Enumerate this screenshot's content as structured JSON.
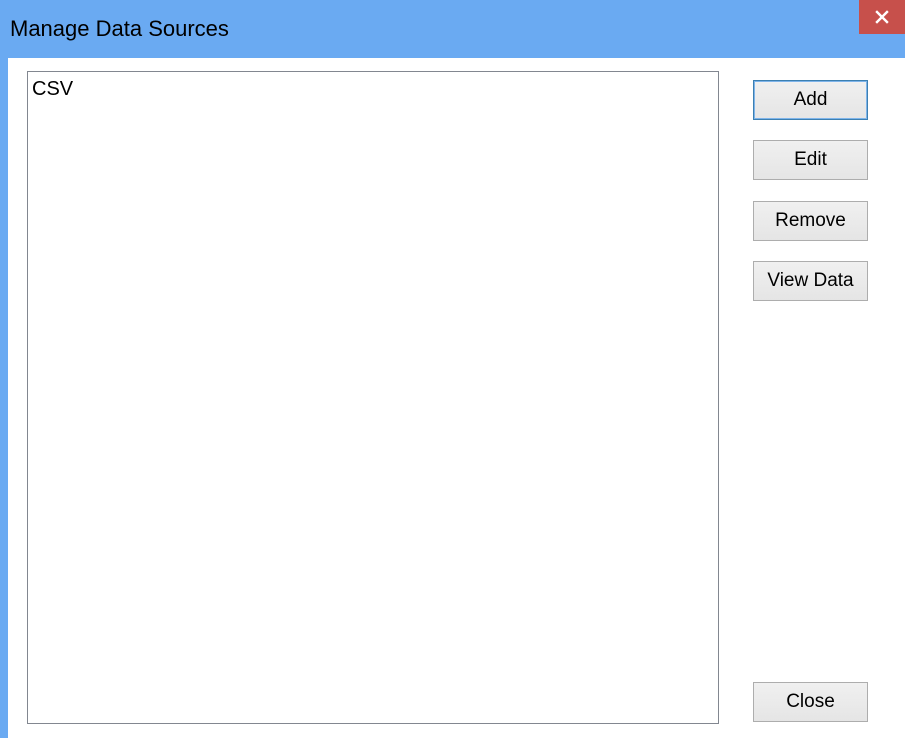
{
  "window": {
    "title": "Manage Data Sources",
    "close_icon": "close-icon",
    "titlebar_color": "#6aaaf2",
    "close_color": "#c7504b"
  },
  "data_sources": {
    "items": [
      "CSV"
    ]
  },
  "buttons": {
    "add": "Add",
    "edit": "Edit",
    "remove": "Remove",
    "view_data": "View Data",
    "close": "Close"
  }
}
